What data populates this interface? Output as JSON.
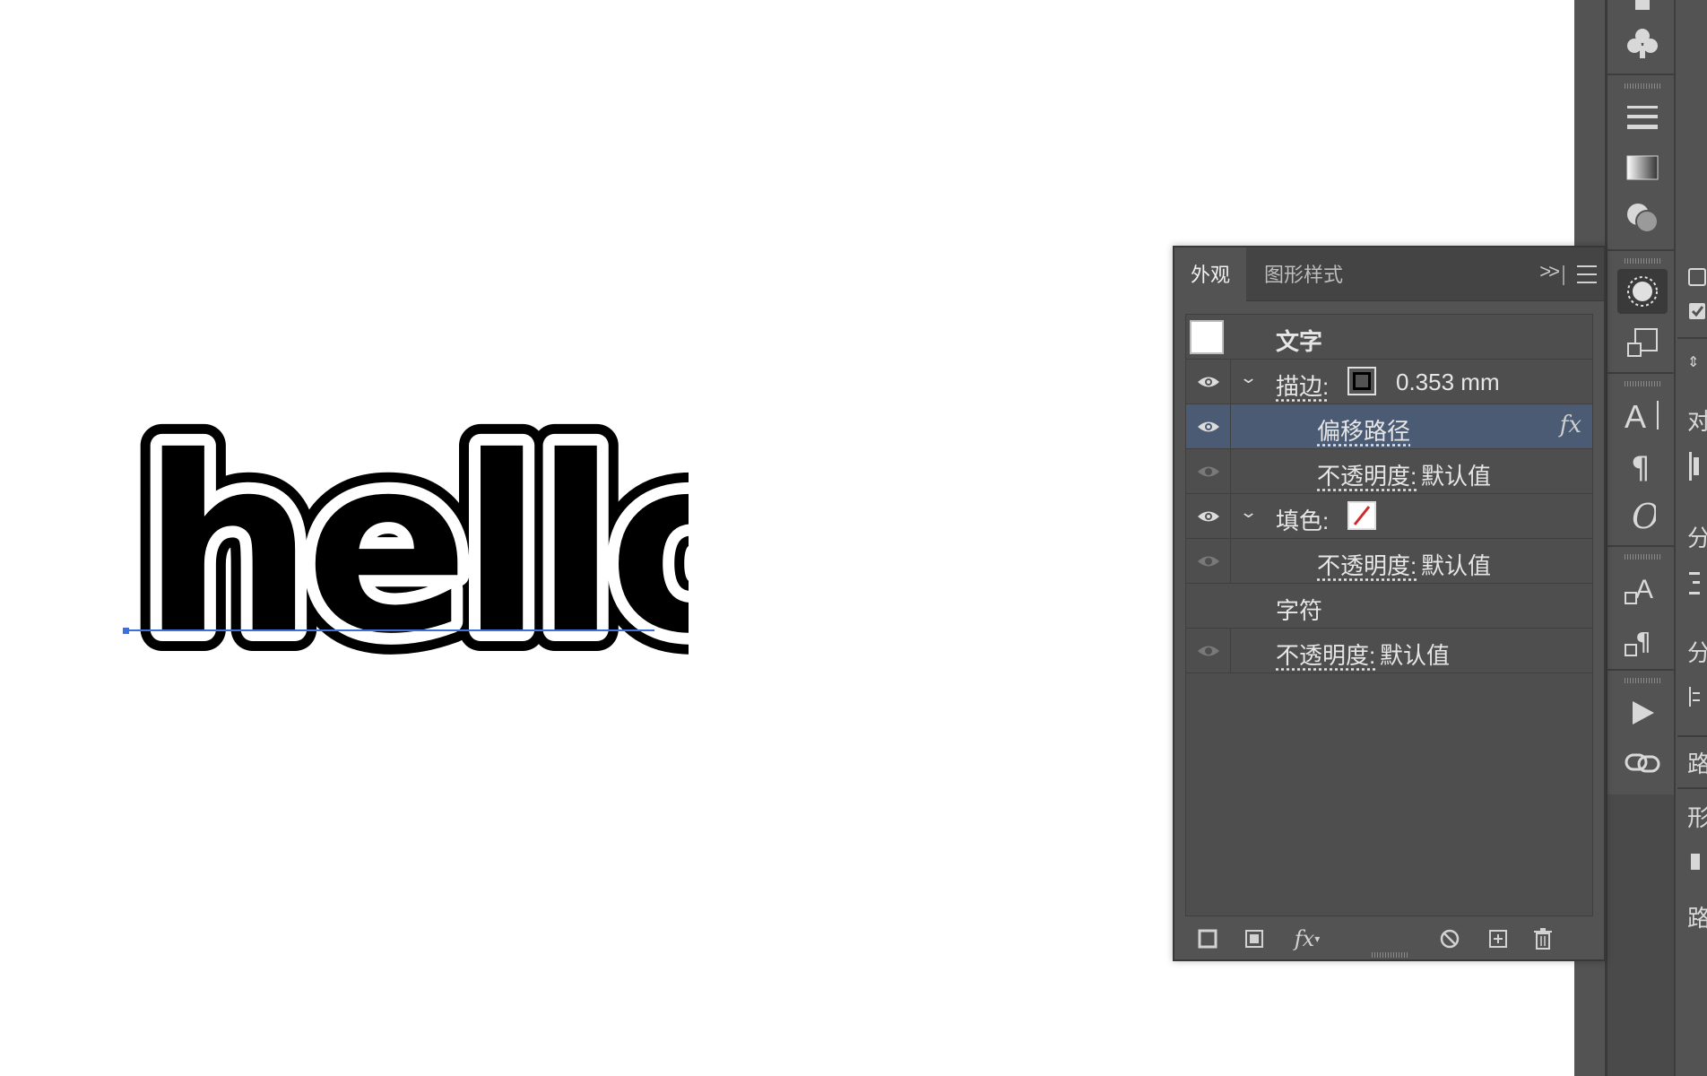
{
  "canvas": {
    "text": "hello"
  },
  "panel": {
    "tabs": [
      {
        "label": "外观",
        "active": true
      },
      {
        "label": "图形样式",
        "active": false
      }
    ],
    "collapse_label": ">>",
    "rows": {
      "text_header": "文字",
      "stroke_label": "描边:",
      "stroke_value": "0.353 mm",
      "offset_path": "偏移路径",
      "fx_mark": "fx",
      "opacity_label": "不透明度:",
      "default_value": "默认值",
      "fill_label": "填色:",
      "characters": "字符"
    },
    "footer": {
      "fx_label": "fx"
    }
  },
  "right_strip": {
    "items": [
      "对",
      "分",
      "分",
      "路",
      "形",
      "路"
    ]
  },
  "colors": {
    "panel_bg": "#535353",
    "selection": "#4b5b73",
    "accent_line": "#3f6fd8",
    "stroke_swatch": "#000000",
    "no_fill_slash": "#d22a2a"
  }
}
